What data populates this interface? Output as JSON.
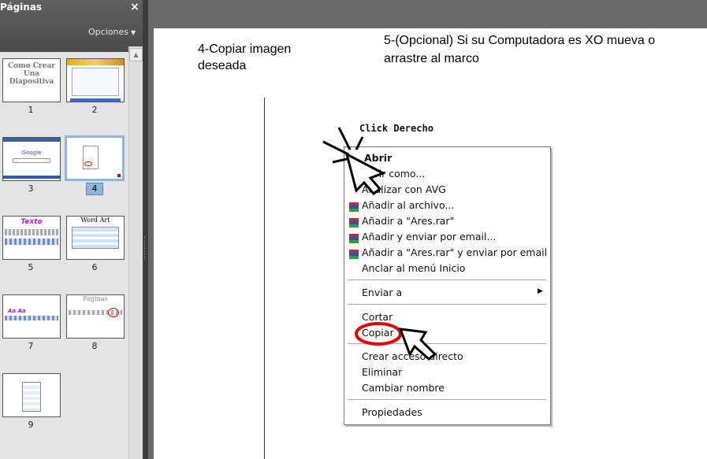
{
  "panel": {
    "title": "Páginas",
    "close_label": "×",
    "options_label": "Opciones",
    "selected_page": "4",
    "pages": [
      {
        "num": "1",
        "thumb_text": "Como Crear Una Diapositiva"
      },
      {
        "num": "2",
        "thumb_text": ""
      },
      {
        "num": "3",
        "thumb_text": "Google"
      },
      {
        "num": "4",
        "thumb_text": ""
      },
      {
        "num": "5",
        "thumb_text": "Texto"
      },
      {
        "num": "6",
        "thumb_text": "Word Art"
      },
      {
        "num": "7",
        "thumb_text": ""
      },
      {
        "num": "8",
        "thumb_text": "Paginas"
      },
      {
        "num": "9",
        "thumb_text": ""
      }
    ]
  },
  "slide": {
    "step4": "4-Copiar imagen deseada",
    "step5": "5-(Opcional) Si su Computadora es XO mueva o arrastre al marco",
    "click_label": "Click Derecho",
    "menu": {
      "open": "Abrir",
      "open_as": "Abrir como...",
      "avg": "Analizar con AVG",
      "add_archive": "Añadir al archivo...",
      "add_ares": "Añadir a \"Ares.rar\"",
      "add_email": "Añadir y enviar por email...",
      "add_ares_email": "Añadir a \"Ares.rar\" y enviar por email",
      "pin_start": "Anclar al menú Inicio",
      "send_to": "Enviar a",
      "cut": "Cortar",
      "copy": "Copiar",
      "shortcut": "Crear acceso directo",
      "delete": "Eliminar",
      "rename": "Cambiar nombre",
      "properties": "Propiedades"
    }
  },
  "colors": {
    "panel_bg": "#dcdcdc",
    "selection": "#8fb6d8",
    "highlight_circle": "#e00000"
  }
}
